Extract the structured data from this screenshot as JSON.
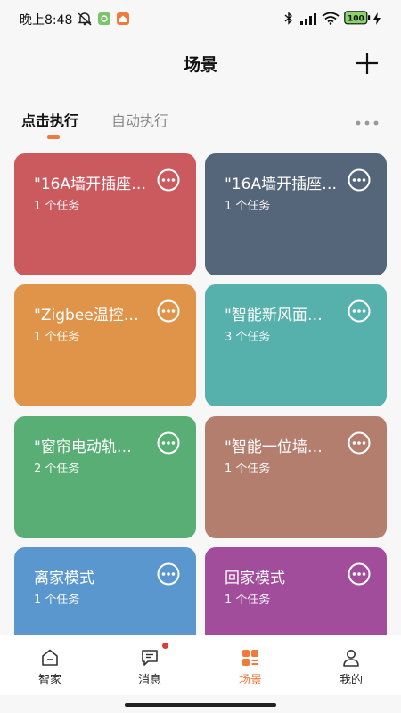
{
  "status_bar": {
    "time": "晚上8:48",
    "battery": "100",
    "icons": [
      "mute-alarm-icon",
      "app-notification-icon",
      "home-app-icon",
      "bluetooth-icon",
      "signal-icon",
      "wifi-icon",
      "battery-icon",
      "charging-icon"
    ]
  },
  "header": {
    "title": "场景",
    "add_icon": "plus-icon"
  },
  "tabs": {
    "items": [
      {
        "label": "点击执行",
        "active": true
      },
      {
        "label": "自动执行",
        "active": false
      }
    ],
    "more_icon": "more-dots-icon"
  },
  "scenes": [
    {
      "title": "\"16A墙开插座…",
      "subtitle": "1 个任务",
      "color": "#cb5a5f"
    },
    {
      "title": "\"16A墙开插座…",
      "subtitle": "1 个任务",
      "color": "#55657a"
    },
    {
      "title": "\"Zigbee温控…",
      "subtitle": "1 个任务",
      "color": "#e0944a"
    },
    {
      "title": "\"智能新风面…",
      "subtitle": "3 个任务",
      "color": "#56b0ab"
    },
    {
      "title": "\"窗帘电动轨…",
      "subtitle": "2 个任务",
      "color": "#58ae74"
    },
    {
      "title": "\"智能一位墙…",
      "subtitle": "1 个任务",
      "color": "#b47e6e"
    },
    {
      "title": "离家模式",
      "subtitle": "1 个任务",
      "color": "#5a97cf"
    },
    {
      "title": "回家模式",
      "subtitle": "1 个任务",
      "color": "#a24d9c"
    }
  ],
  "bottom_nav": {
    "items": [
      {
        "label": "智家",
        "icon": "home-icon",
        "active": false
      },
      {
        "label": "消息",
        "icon": "message-icon",
        "active": false,
        "badge": true
      },
      {
        "label": "场景",
        "icon": "scene-icon",
        "active": true
      },
      {
        "label": "我的",
        "icon": "profile-icon",
        "active": false
      }
    ]
  },
  "colors": {
    "accent": "#f07a3c",
    "badge": "#e53935"
  }
}
